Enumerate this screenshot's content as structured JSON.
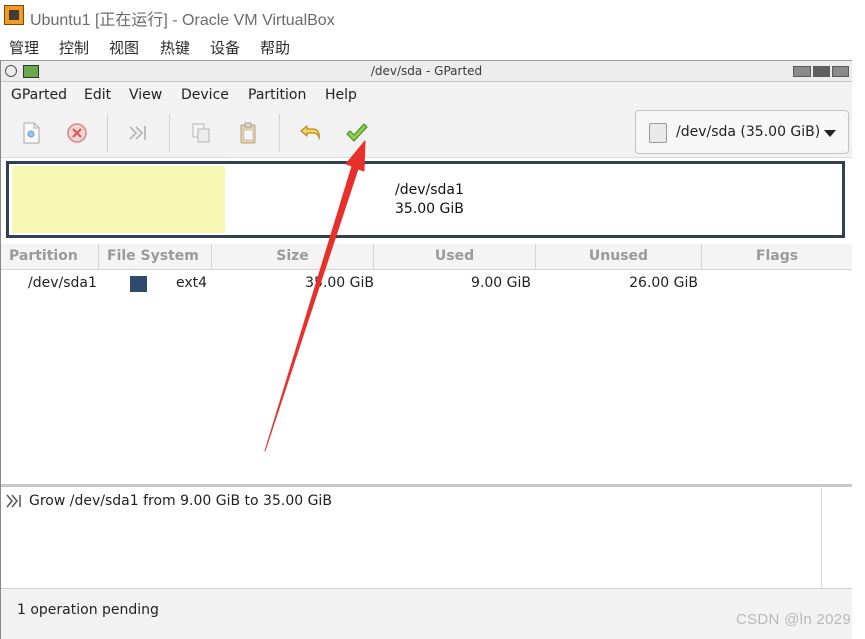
{
  "vbox": {
    "title": "Ubuntu1 [正在运行] - Oracle VM VirtualBox",
    "menu": [
      "管理",
      "控制",
      "视图",
      "热键",
      "设备",
      "帮助"
    ]
  },
  "gparted": {
    "window_title": "/dev/sda - GParted",
    "menu": [
      "GParted",
      "Edit",
      "View",
      "Device",
      "Partition",
      "Help"
    ],
    "toolbar_icons": [
      "new-icon",
      "delete-icon",
      "resize-move-icon",
      "copy-icon",
      "paste-icon",
      "undo-icon",
      "apply-icon"
    ],
    "device_selector": "/dev/sda (35.00 GiB)"
  },
  "disk_graphic": {
    "partition_name": "/dev/sda1",
    "partition_size": "35.00 GiB",
    "used_fraction": 0.2571,
    "used_color": "#f7f7b4",
    "border_color": "#2f4153"
  },
  "table": {
    "columns": [
      "Partition",
      "File System",
      "Size",
      "Used",
      "Unused",
      "Flags"
    ],
    "rows": [
      {
        "partition": "/dev/sda1",
        "filesystem": "ext4",
        "fs_color": "#2f4a6b",
        "size": "35.00 GiB",
        "used": "9.00 GiB",
        "unused": "26.00 GiB",
        "flags": ""
      }
    ]
  },
  "operations": [
    "Grow /dev/sda1 from 9.00 GiB to 35.00 GiB"
  ],
  "status": "1 operation pending",
  "watermark": "CSDN @ln 2029",
  "annotation": {
    "color": "#e8302a"
  }
}
